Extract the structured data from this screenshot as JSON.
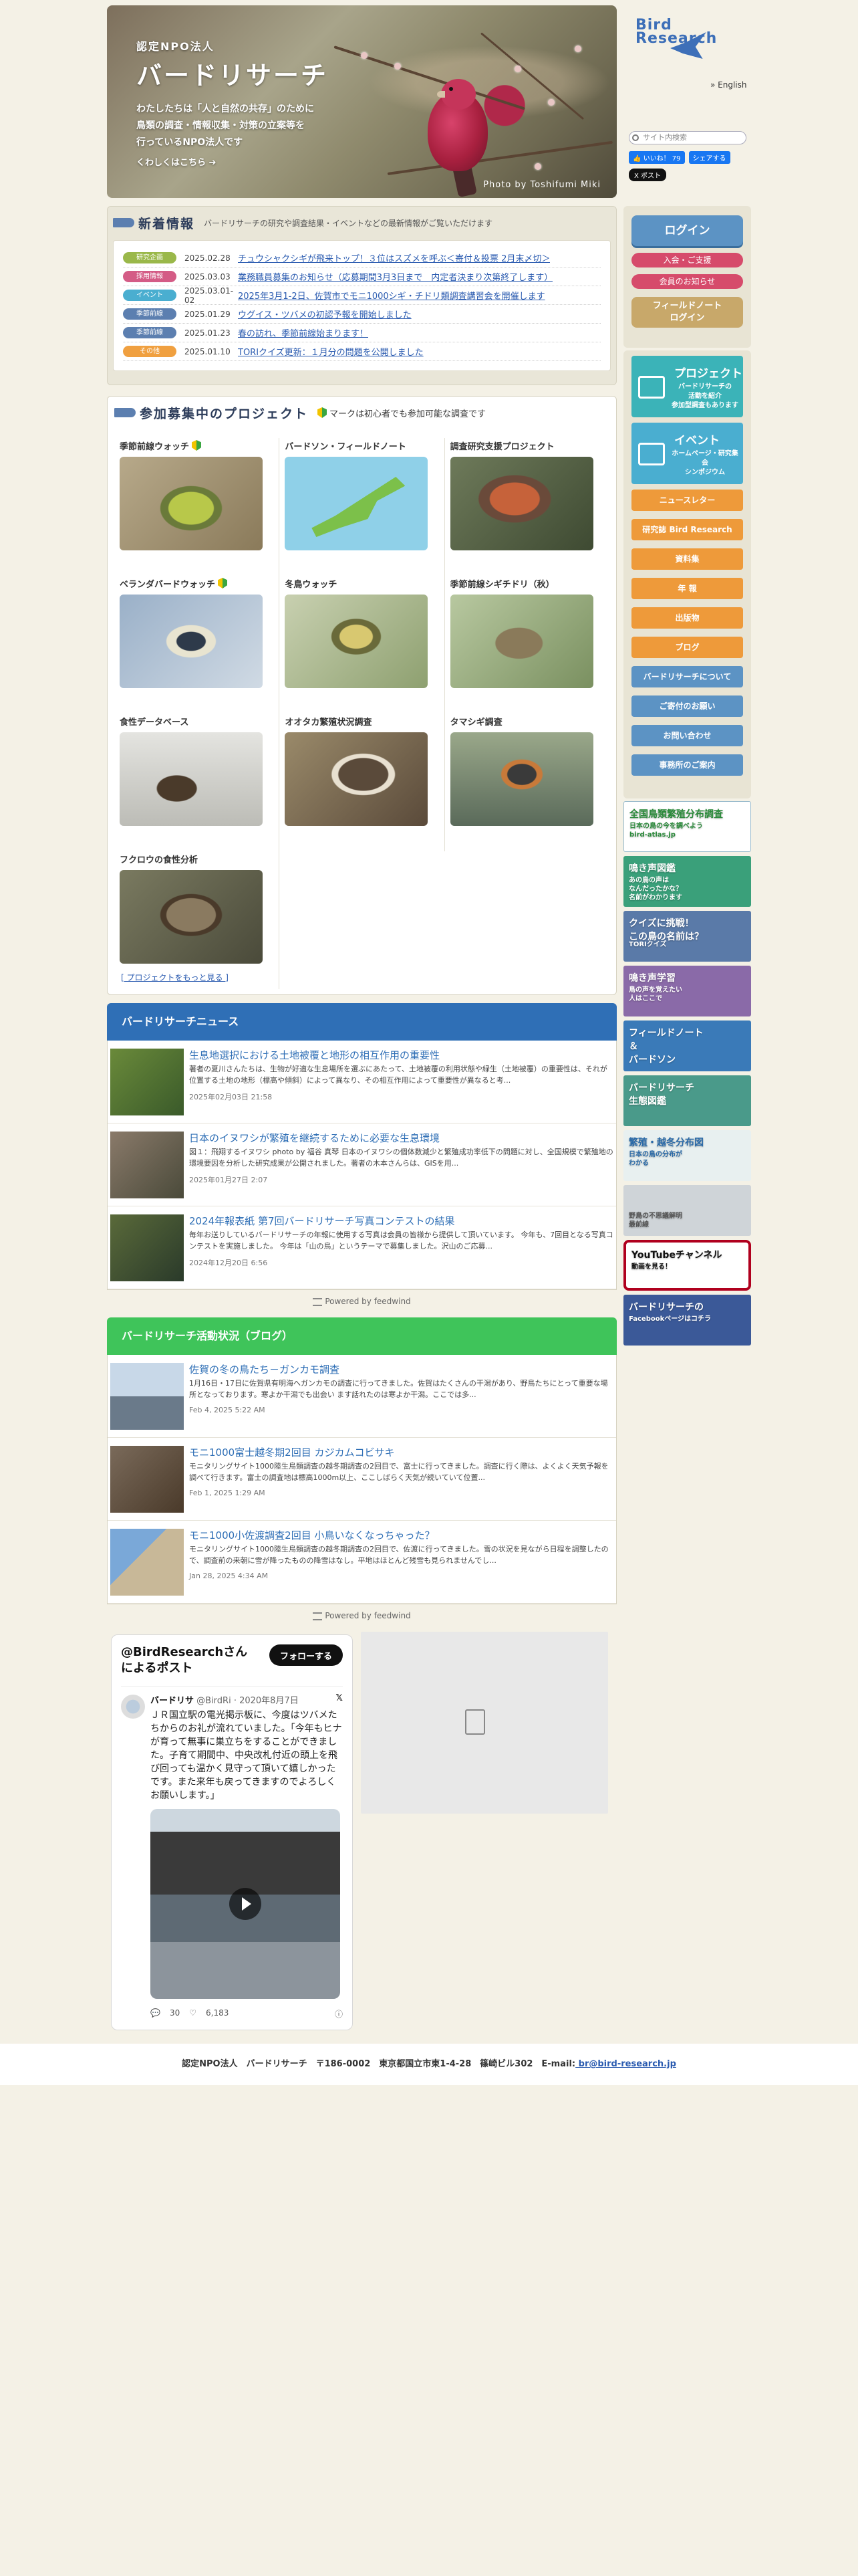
{
  "hero": {
    "sub": "認定NPO法人",
    "name": "バードリサーチ",
    "lines": [
      "わたしたちは「人と自然の共存」のために",
      "鳥類の調査・情報収集・対策の立案等を",
      "行っているNPO法人です"
    ],
    "more": "くわしくはこちら ➔",
    "credit": "Photo by Toshifumi Miki"
  },
  "news": {
    "title": "新着情報",
    "desc": "バードリサーチの研究や調査結果・イベントなどの最新情報がご覧いただけます",
    "items": [
      {
        "tag": "研究企画",
        "tag_color": "#9ab84a",
        "date": "2025.02.28",
        "text": "チュウシャクシギが飛来トップ！３位はスズメを呼ぶ＜寄付＆投票 2月末〆切＞"
      },
      {
        "tag": "採用情報",
        "tag_color": "#d45c86",
        "date": "2025.03.03",
        "text": "業務職員募集のお知らせ（応募期間3月3日まで　内定者決まり次第終了します）"
      },
      {
        "tag": "イベント",
        "tag_color": "#4aaed0",
        "date": "2025.03.01-02",
        "text": "2025年3月1-2日、佐賀市でモニ1000シギ・チドリ類調査講習会を開催します"
      },
      {
        "tag": "季節前線",
        "tag_color": "#5c7fb0",
        "date": "2025.01.29",
        "text": "ウグイス・ツバメの初認予報を開始しました"
      },
      {
        "tag": "季節前線",
        "tag_color": "#5c7fb0",
        "date": "2025.01.23",
        "text": "春の訪れ、季節前線始まります！"
      },
      {
        "tag": "その他",
        "tag_color": "#f0a040",
        "date": "2025.01.10",
        "text": "TORIクイズ更新：１月分の問題を公開しました"
      }
    ]
  },
  "projects": {
    "title": "参加募集中のプロジェクト",
    "note": "マークは初心者でも参加可能な調査です",
    "items": [
      {
        "name": "季節前線ウォッチ",
        "beginner": true
      },
      {
        "name": "バードソン・フィールドノート",
        "beginner": false
      },
      {
        "name": "調査研究支援プロジェクト",
        "beginner": false
      },
      {
        "name": "ベランダバードウォッチ",
        "beginner": true
      },
      {
        "name": "冬鳥ウォッチ",
        "beginner": false
      },
      {
        "name": "季節前線シギチドリ（秋）",
        "beginner": false
      },
      {
        "name": "食性データベース",
        "beginner": false
      },
      {
        "name": "オオタカ繁殖状況調査",
        "beginner": false
      },
      {
        "name": "タマシギ調査",
        "beginner": false
      },
      {
        "name": "フクロウの食性分析",
        "beginner": false
      }
    ],
    "more": "[ プロジェクトをもっと見る ]"
  },
  "birdnews": {
    "title": "バードリサーチニュース",
    "items": [
      {
        "title": "生息地選択における土地被覆と地形の相互作用の重要性",
        "desc": "著者の夏川さんたちは、生物が好適な生息場所を選ぶにあたって、土地被覆の利用状態や緑生（土地被覆）の重要性は、それが位置する土地の地形（標高や傾斜）によって異なり、その相互作用によって重要性が異なると考...",
        "date": "2025年02月03日 21:58"
      },
      {
        "title": "日本のイヌワシが繁殖を継続するために必要な生息環境",
        "desc": "図１：飛翔するイヌワシ photo by 福谷 真琴 日本のイヌワシの個体数減少と繁殖成功率低下の問題に対し、全国規模で繁殖地の環境要因を分析した研究成果が公開されました。著者の木本さんらは、GISを用...",
        "date": "2025年01月27日 2:07"
      },
      {
        "title": "2024年報表紙 第7回バードリサーチ写真コンテストの結果",
        "desc": "毎年お送りしているバードリサーチの年報に使用する写真は会員の皆様から提供して頂いています。 今年も、7回目となる写真コンテストを実施しました。 今年は「山の鳥」というテーマで募集しました。沢山のご応募...",
        "date": "2024年12月20日 6:56"
      }
    ],
    "powered": "Powered by feedwind"
  },
  "blog": {
    "title": "バードリサーチ活動状況（ブログ）",
    "items": [
      {
        "title": "佐賀の冬の鳥たち－ガンカモ調査",
        "desc": "1月16日・17日に佐賀県有明海へガンカモの調査に行ってきました。佐賀はたくさんの干潟があり、野鳥たちにとって重要な場所となっております。寒よか干潟でも出会い ます話れたのは寒よか干潟。ここでは多...",
        "date": "Feb 4, 2025 5:22 AM"
      },
      {
        "title": "モニ1000富士越冬期2回目 カジカムコビサキ",
        "desc": "モニタリングサイト1000陸生鳥類調査の越冬期調査の2回目で、富士に行ってきました。調査に行く際は、よくよく天気予報を調べて行きます。富士の調査地は標高1000m以上、ここしばらく天気が続いていて位置...",
        "date": "Feb 1, 2025 1:29 AM"
      },
      {
        "title": "モニ1000小佐渡調査2回目 小鳥いなくなっちゃった？",
        "desc": "モニタリングサイト1000陸生鳥類調査の越冬期調査の2回目で、佐渡に行ってきました。雪の状況を見ながら日程を調整したので、調査前の来朝に雪が降ったものの降雪はなし。平地はほとんど残雪も見られませんでし...",
        "date": "Jan 28, 2025 4:34 AM"
      }
    ],
    "powered": "Powered by feedwind"
  },
  "xembed": {
    "title": "@BirdResearchさんによるポスト",
    "follow": "フォローする",
    "author": "バードリサ",
    "handle": "@BirdRi · 2020年8月7日",
    "text": "ＪＲ国立駅の電光掲示板に、今度はツバメたちからのお礼が流れていました。「今年もヒナが育って無事に巣立ちをすることができました。子育て期間中、中央改札付近の頭上を飛び回っても温かく見守って頂いて嬉しかったです。また来年も戻ってきますのでよろしくお願いします。」",
    "likes": "30",
    "views": "6,183"
  },
  "side": {
    "logo": "Bird Research",
    "english": "» English",
    "search_placeholder": "サイト内検索",
    "fb_like": "👍 いいね！ 79",
    "fb_share": "シェアする",
    "x_post": "X ポスト",
    "login": "ログイン",
    "join": "入会・ご支援",
    "member": "会員のお知らせ",
    "fn_login": "フィールドノート\nログイン",
    "tiles": [
      {
        "title": "プロジェクト",
        "sub": "バードリサーチの\n活動を紹介\n参加型調査もあります",
        "color": "#3bb3b8"
      },
      {
        "title": "イベント",
        "sub": "ホームページ・研究集会\nシンポジウム",
        "color": "#4aaed0"
      }
    ],
    "nav": [
      {
        "label": "ニュースレター",
        "color": "#ee9a3a"
      },
      {
        "label": "研究誌 Bird Research",
        "color": "#ee9a3a"
      },
      {
        "label": "資料集",
        "color": "#ee9a3a"
      },
      {
        "label": "年 報",
        "color": "#ee9a3a"
      },
      {
        "label": "出版物",
        "color": "#ee9a3a"
      },
      {
        "label": "ブログ",
        "color": "#ee9a3a"
      },
      {
        "label": "バードリサーチについて",
        "color": "#5c93c4"
      },
      {
        "label": "ご寄付のお願い",
        "color": "#5c93c4"
      },
      {
        "label": "お問い合わせ",
        "color": "#5c93c4"
      },
      {
        "label": "事務所のご案内",
        "color": "#5c93c4"
      }
    ],
    "banners": [
      {
        "title": "全国鳥類繁殖分布調査",
        "sub": "日本の鳥の今を調べよう\nbird-atlas.jp",
        "color": "#ffffff",
        "text_color": "#2a8a3a"
      },
      {
        "title": "鳴き声図鑑",
        "sub": "あの鳥の声は\nなんだったかな？\n名前がわかります",
        "color": "#3aa07a",
        "text_color": "#ffffff"
      },
      {
        "title": "クイズに挑戦！\nこの鳥の名前は？",
        "sub": "TORIクイズ",
        "color": "#5a7aa8",
        "text_color": "#ffffff"
      },
      {
        "title": "鳴き声学習",
        "sub": "鳥の声を覚えたい\n人はここで",
        "color": "#8a6aa8",
        "text_color": "#ffffff"
      },
      {
        "title": "フィールドノート\n＆\nバードソン",
        "sub": "",
        "color": "#3a7ab8",
        "text_color": "#ffffff"
      },
      {
        "title": "バードリサーチ\n生態図鑑",
        "sub": "",
        "color": "#4a9a8a",
        "text_color": "#ffffff"
      },
      {
        "title": "繁殖・越冬分布図",
        "sub": "日本の鳥の分布が\nわかる",
        "color": "#e8f0f0",
        "text_color": "#2a6aa8"
      },
      {
        "title": "",
        "sub": "野鳥の不思議解明\n最前線",
        "color": "#cfd4d8",
        "text_color": "#555555"
      },
      {
        "title": "YouTubeチャンネル",
        "sub": "動画を見る！",
        "color": "#ffffff",
        "text_color": "#111111"
      },
      {
        "title": "バードリサーチの",
        "sub": "Facebookページはコチラ",
        "color": "#3b5998",
        "text_color": "#ffffff"
      }
    ]
  },
  "footer": {
    "text": "認定NPO法人　バードリサーチ　〒186-0002　東京都国立市東1-4-28　篠崎ビル302　E-mail:",
    "mail": " br@bird-research.jp"
  }
}
